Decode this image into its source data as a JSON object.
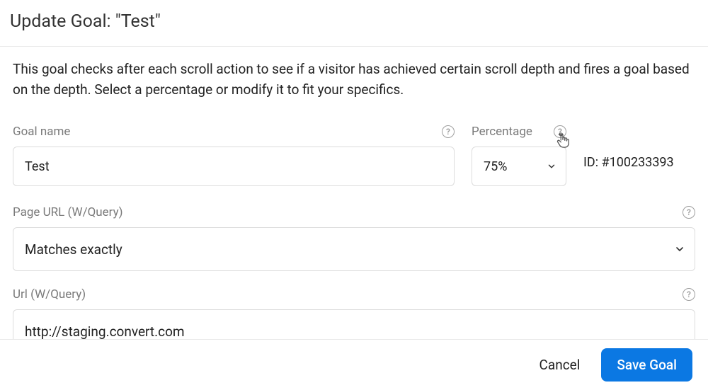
{
  "header": {
    "title": "Update Goal: \"Test\""
  },
  "description": "This goal checks after each scroll action to see if a visitor has achieved certain scroll depth and fires a goal based on the depth. Select a percentage or modify it to fit your specifics.",
  "fields": {
    "goal_name": {
      "label": "Goal name",
      "value": "Test"
    },
    "percentage": {
      "label": "Percentage",
      "value": "75%"
    },
    "id": {
      "text": "ID: #100233393"
    },
    "page_url": {
      "label": "Page URL (W/Query)",
      "value": "Matches exactly"
    },
    "url": {
      "label": "Url (W/Query)",
      "value": "http://staging.convert.com"
    }
  },
  "footer": {
    "cancel": "Cancel",
    "save": "Save Goal"
  }
}
